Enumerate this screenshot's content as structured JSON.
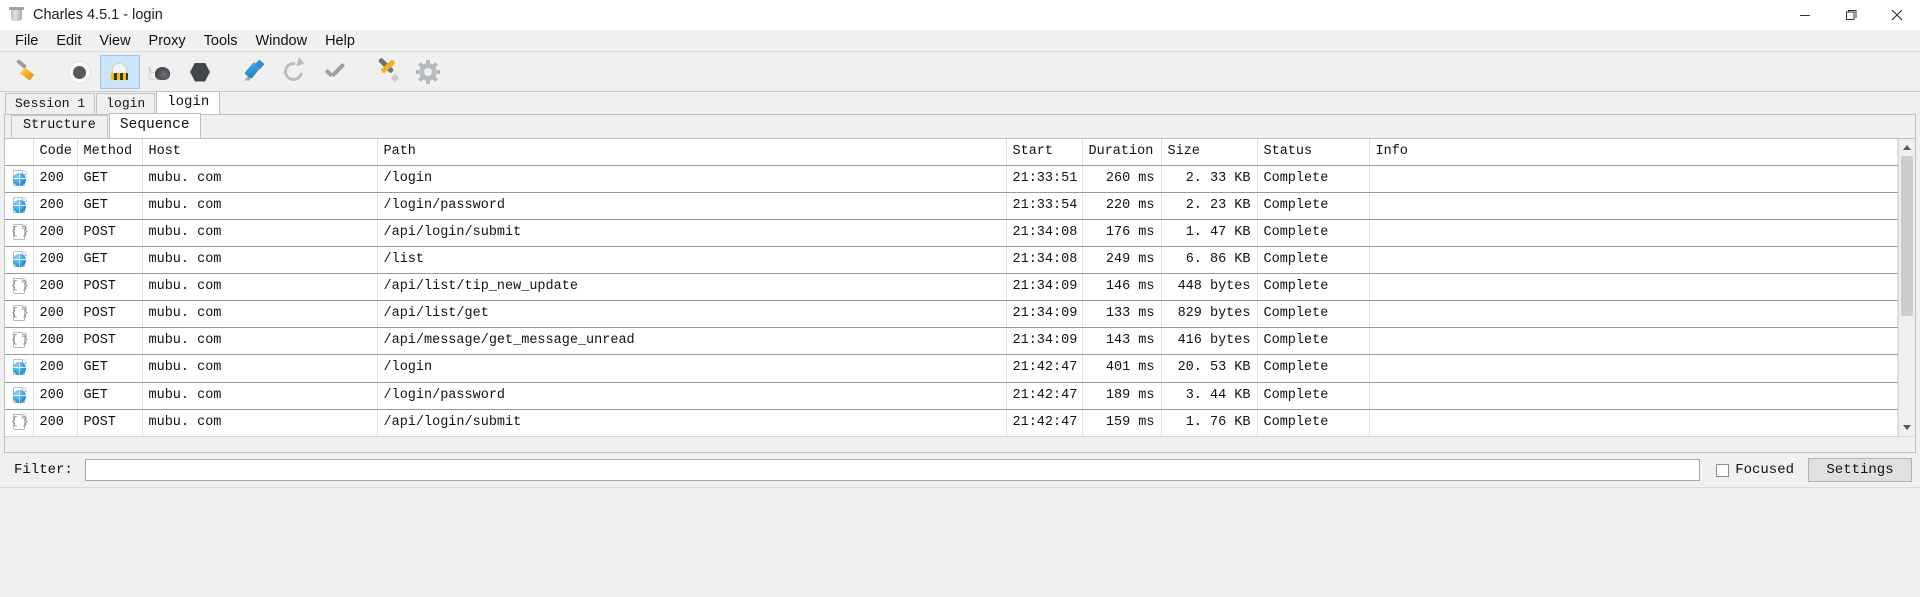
{
  "window": {
    "title": "Charles 4.5.1 - login",
    "app_icon": "charles-jar-icon",
    "controls": {
      "minimize": "minimize-icon",
      "restore": "restore-icon",
      "close": "close-icon"
    }
  },
  "menubar": {
    "items": [
      "File",
      "Edit",
      "View",
      "Proxy",
      "Tools",
      "Window",
      "Help"
    ]
  },
  "toolbar": {
    "buttons": [
      {
        "name": "clear-session-button",
        "icon": "broom-icon",
        "active": false
      },
      {
        "name": "record-button",
        "icon": "record-circle-icon",
        "active": false
      },
      {
        "name": "throttle-button",
        "icon": "throttle-truck-icon",
        "active": true
      },
      {
        "name": "start-throttling-button",
        "icon": "snail-icon",
        "active": false
      },
      {
        "name": "breakpoints-button",
        "icon": "hexagon-icon",
        "active": false
      },
      {
        "name": "compose-button",
        "icon": "pen-icon",
        "active": false
      },
      {
        "name": "repeat-button",
        "icon": "refresh-arrow-icon",
        "active": false
      },
      {
        "name": "validate-button",
        "icon": "checkmark-icon",
        "active": false
      },
      {
        "name": "tools-button",
        "icon": "wrench-screwdriver-icon",
        "active": false
      },
      {
        "name": "settings-button",
        "icon": "gear-icon",
        "active": false
      }
    ]
  },
  "session_tabs": {
    "items": [
      {
        "label": "Session 1",
        "selected": false
      },
      {
        "label": "login",
        "selected": false
      },
      {
        "label": "login",
        "selected": true
      }
    ]
  },
  "view_tabs": {
    "items": [
      {
        "label": "Structure",
        "selected": false
      },
      {
        "label": "Sequence",
        "selected": true
      }
    ]
  },
  "table": {
    "columns": [
      {
        "key": "icon",
        "label": "",
        "align": "left"
      },
      {
        "key": "code",
        "label": "Code",
        "align": "left"
      },
      {
        "key": "method",
        "label": "Method",
        "align": "left"
      },
      {
        "key": "host",
        "label": "Host",
        "align": "left"
      },
      {
        "key": "path",
        "label": "Path",
        "align": "left"
      },
      {
        "key": "start",
        "label": "Start",
        "align": "left"
      },
      {
        "key": "duration",
        "label": "Duration",
        "align": "right"
      },
      {
        "key": "size",
        "label": "Size",
        "align": "right"
      },
      {
        "key": "status",
        "label": "Status",
        "align": "left"
      },
      {
        "key": "info",
        "label": "Info",
        "align": "left"
      }
    ],
    "rows": [
      {
        "icon": "globe-icon",
        "code": "200",
        "method": "GET",
        "host": "mubu. com",
        "path": "/login",
        "start": "21:33:51",
        "duration": "260 ms",
        "size": "2. 33 KB",
        "status": "Complete",
        "info": ""
      },
      {
        "icon": "globe-icon",
        "code": "200",
        "method": "GET",
        "host": "mubu. com",
        "path": "/login/password",
        "start": "21:33:54",
        "duration": "220 ms",
        "size": "2. 23 KB",
        "status": "Complete",
        "info": ""
      },
      {
        "icon": "json-icon",
        "code": "200",
        "method": "POST",
        "host": "mubu. com",
        "path": "/api/login/submit",
        "start": "21:34:08",
        "duration": "176 ms",
        "size": "1. 47 KB",
        "status": "Complete",
        "info": ""
      },
      {
        "icon": "globe-icon",
        "code": "200",
        "method": "GET",
        "host": "mubu. com",
        "path": "/list",
        "start": "21:34:08",
        "duration": "249 ms",
        "size": "6. 86 KB",
        "status": "Complete",
        "info": ""
      },
      {
        "icon": "json-icon",
        "code": "200",
        "method": "POST",
        "host": "mubu. com",
        "path": "/api/list/tip_new_update",
        "start": "21:34:09",
        "duration": "146 ms",
        "size": "448 bytes",
        "status": "Complete",
        "info": ""
      },
      {
        "icon": "json-icon",
        "code": "200",
        "method": "POST",
        "host": "mubu. com",
        "path": "/api/list/get",
        "start": "21:34:09",
        "duration": "133 ms",
        "size": "829 bytes",
        "status": "Complete",
        "info": ""
      },
      {
        "icon": "json-icon",
        "code": "200",
        "method": "POST",
        "host": "mubu. com",
        "path": "/api/message/get_message_unread",
        "start": "21:34:09",
        "duration": "143 ms",
        "size": "416 bytes",
        "status": "Complete",
        "info": ""
      },
      {
        "icon": "globe-icon",
        "code": "200",
        "method": "GET",
        "host": "mubu. com",
        "path": "/login",
        "start": "21:42:47",
        "duration": "401 ms",
        "size": "20. 53 KB",
        "status": "Complete",
        "info": ""
      },
      {
        "icon": "globe-icon",
        "code": "200",
        "method": "GET",
        "host": "mubu. com",
        "path": "/login/password",
        "start": "21:42:47",
        "duration": "189 ms",
        "size": "3. 44 KB",
        "status": "Complete",
        "info": ""
      },
      {
        "icon": "json-icon",
        "code": "200",
        "method": "POST",
        "host": "mubu. com",
        "path": "/api/login/submit",
        "start": "21:42:47",
        "duration": "159 ms",
        "size": "1. 76 KB",
        "status": "Complete",
        "info": ""
      }
    ]
  },
  "filterbar": {
    "label": "Filter:",
    "value": "",
    "placeholder": "",
    "focused_label": "Focused",
    "focused_checked": false,
    "settings_label": "Settings"
  },
  "colors": {
    "window_bg": "#f0f0f0",
    "panel_bg": "#ffffff",
    "active_toolbar": "#cce4f7",
    "globe_accent": "#2b9fe0",
    "grid_line": "#9a9a9a"
  }
}
